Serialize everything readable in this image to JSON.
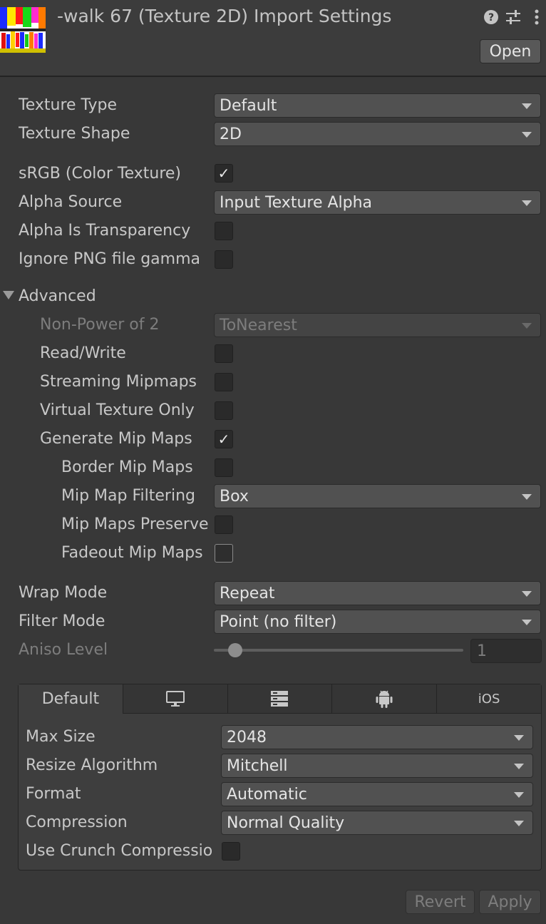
{
  "header": {
    "title": "-walk 67 (Texture 2D) Import Settings",
    "open_button": "Open",
    "icons": [
      "help-icon",
      "preset-sliders-icon",
      "kebab-menu-icon"
    ]
  },
  "main": {
    "texture_type": {
      "label": "Texture Type",
      "value": "Default"
    },
    "texture_shape": {
      "label": "Texture Shape",
      "value": "2D"
    },
    "srgb": {
      "label": "sRGB (Color Texture)",
      "checked": true
    },
    "alpha_source": {
      "label": "Alpha Source",
      "value": "Input Texture Alpha"
    },
    "alpha_is_transparency": {
      "label": "Alpha Is Transparency",
      "checked": false
    },
    "ignore_png_gamma": {
      "label": "Ignore PNG file gamma",
      "checked": false
    }
  },
  "advanced": {
    "label": "Advanced",
    "expanded": true,
    "non_power_of_2": {
      "label": "Non-Power of 2",
      "value": "ToNearest",
      "disabled": true
    },
    "read_write": {
      "label": "Read/Write",
      "checked": false
    },
    "streaming_mipmaps": {
      "label": "Streaming Mipmaps",
      "checked": false
    },
    "virtual_texture_only": {
      "label": "Virtual Texture Only",
      "checked": false
    },
    "generate_mip_maps": {
      "label": "Generate Mip Maps",
      "checked": true
    },
    "border_mip_maps": {
      "label": "Border Mip Maps",
      "checked": false
    },
    "mip_map_filtering": {
      "label": "Mip Map Filtering",
      "value": "Box"
    },
    "mip_maps_preserve": {
      "label": "Mip Maps Preserve",
      "checked": false
    },
    "fadeout_mip_maps": {
      "label": "Fadeout Mip Maps",
      "checked": false
    }
  },
  "sampling": {
    "wrap_mode": {
      "label": "Wrap Mode",
      "value": "Repeat"
    },
    "filter_mode": {
      "label": "Filter Mode",
      "value": "Point (no filter)"
    },
    "aniso_level": {
      "label": "Aniso Level",
      "value": "1",
      "slider_fraction": 0.06
    }
  },
  "platform": {
    "tabs": [
      {
        "label": "Default",
        "icon": null,
        "active": true
      },
      {
        "label": "",
        "icon": "monitor-icon",
        "active": false
      },
      {
        "label": "",
        "icon": "server-icon",
        "active": false
      },
      {
        "label": "",
        "icon": "android-icon",
        "active": false
      },
      {
        "label": "iOS",
        "icon": null,
        "active": false
      }
    ],
    "max_size": {
      "label": "Max Size",
      "value": "2048"
    },
    "resize_algorithm": {
      "label": "Resize Algorithm",
      "value": "Mitchell"
    },
    "format": {
      "label": "Format",
      "value": "Automatic"
    },
    "compression": {
      "label": "Compression",
      "value": "Normal Quality"
    },
    "use_crunch": {
      "label": "Use Crunch Compressio",
      "checked": false
    }
  },
  "footer": {
    "revert": "Revert",
    "apply": "Apply"
  }
}
